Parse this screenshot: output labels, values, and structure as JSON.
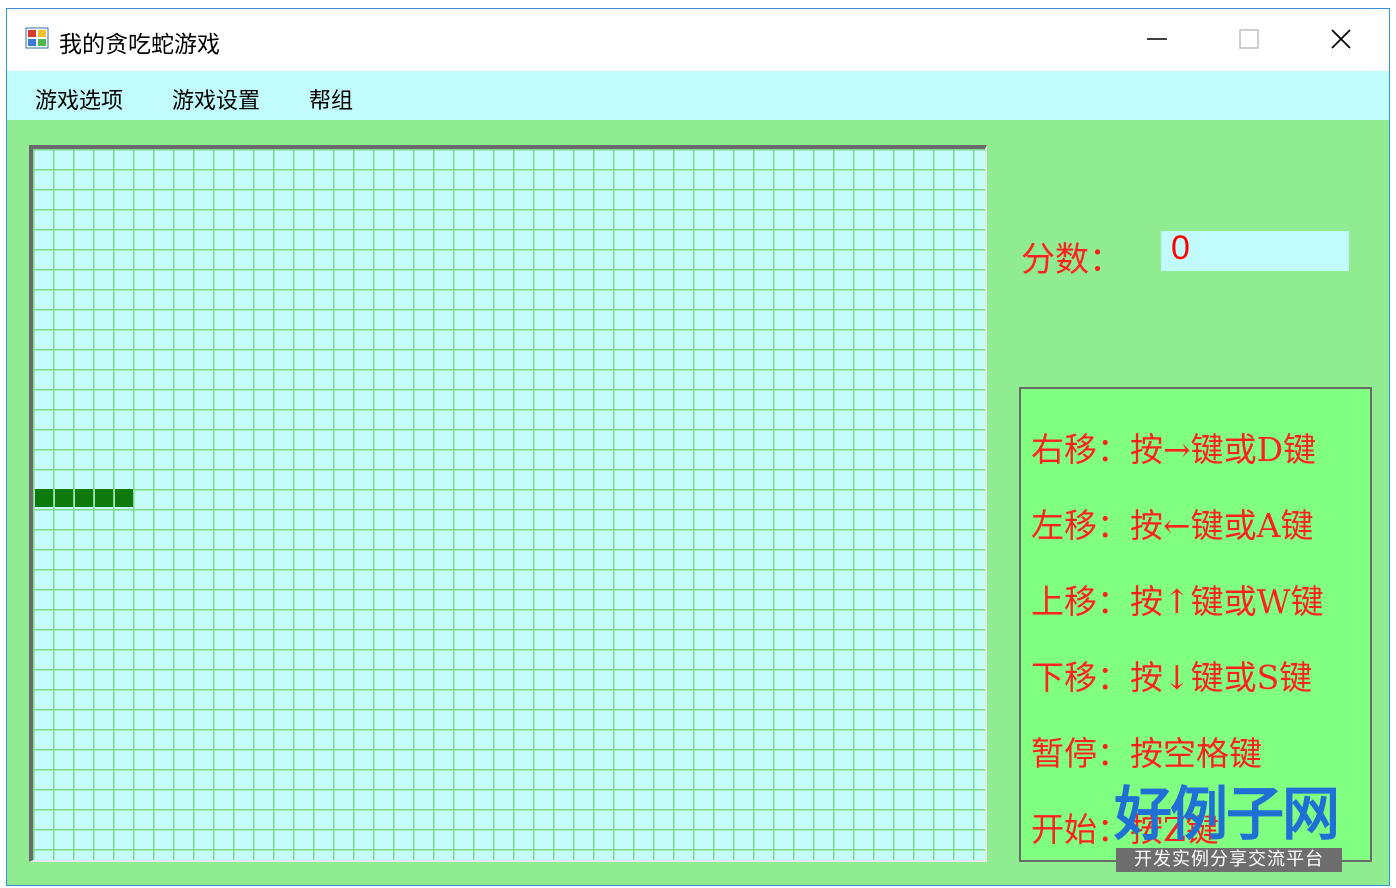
{
  "window": {
    "title": "我的贪吃蛇游戏",
    "controls": {
      "minimize": "minimize",
      "maximize": "maximize",
      "close": "close"
    }
  },
  "menu": {
    "items": [
      {
        "label": "游戏选项"
      },
      {
        "label": "游戏设置"
      },
      {
        "label": "帮组"
      }
    ]
  },
  "game": {
    "board": {
      "columns": 48,
      "rows": 36,
      "grid_color": "#7fd98a",
      "background": "#c4fcfc"
    },
    "snake": {
      "color": "#0e7a0e",
      "row": 17,
      "start_col": 0,
      "length": 5
    }
  },
  "score": {
    "label": "分数：",
    "value": "0"
  },
  "help": {
    "lines": [
      "右移：按→键或D键",
      "左移：按←键或A键",
      "上移：按↑键或W键",
      "下移：按↓键或S键",
      "暂停：按空格键",
      "开始：按Z键"
    ],
    "text_color": "#ff2020"
  },
  "watermark": {
    "brand": "好例子网",
    "slogan": "开发实例分享交流平台"
  },
  "colors": {
    "menubar": "#c2fbfc",
    "client": "#90ec90",
    "help_panel": "#80ff80",
    "accent_border": "#3b8ede"
  }
}
